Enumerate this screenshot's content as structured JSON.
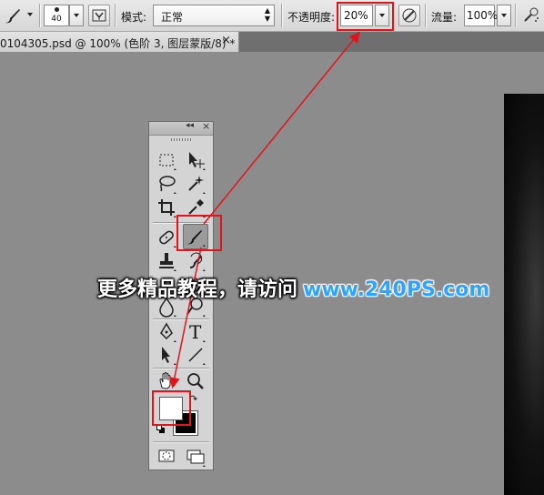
{
  "options_bar": {
    "brush_size": "40",
    "mode_label": "模式:",
    "mode_value": "正常",
    "opacity_label": "不透明度:",
    "opacity_value": "20%",
    "flow_label": "流量:",
    "flow_value": "100%"
  },
  "document_tab": {
    "title": "0104305.psd @ 100% (色阶 3, 图层蒙版/8) *",
    "close_glyph": "×"
  },
  "tools_panel": {
    "header_collapse": "◂◂",
    "header_close": "×",
    "active_tool": "brush",
    "tools": [
      "marquee",
      "move",
      "lasso",
      "magic-wand",
      "crop",
      "eyedropper",
      "healing",
      "brush",
      "stamp",
      "history-brush",
      "eraser",
      "paint-bucket",
      "blur",
      "dodge",
      "pen",
      "type",
      "path-selection",
      "line",
      "hand",
      "zoom"
    ],
    "type_glyph": "T",
    "foreground_color": "#ffffff",
    "background_color": "#000000"
  },
  "watermark": {
    "cn_text": "更多精品教程，请访问",
    "url": "www.240PS.com"
  },
  "colors": {
    "annotation_red": "#e3131b",
    "watermark_blue": "#2fa4ff",
    "workspace_gray": "#8c8c8c"
  }
}
